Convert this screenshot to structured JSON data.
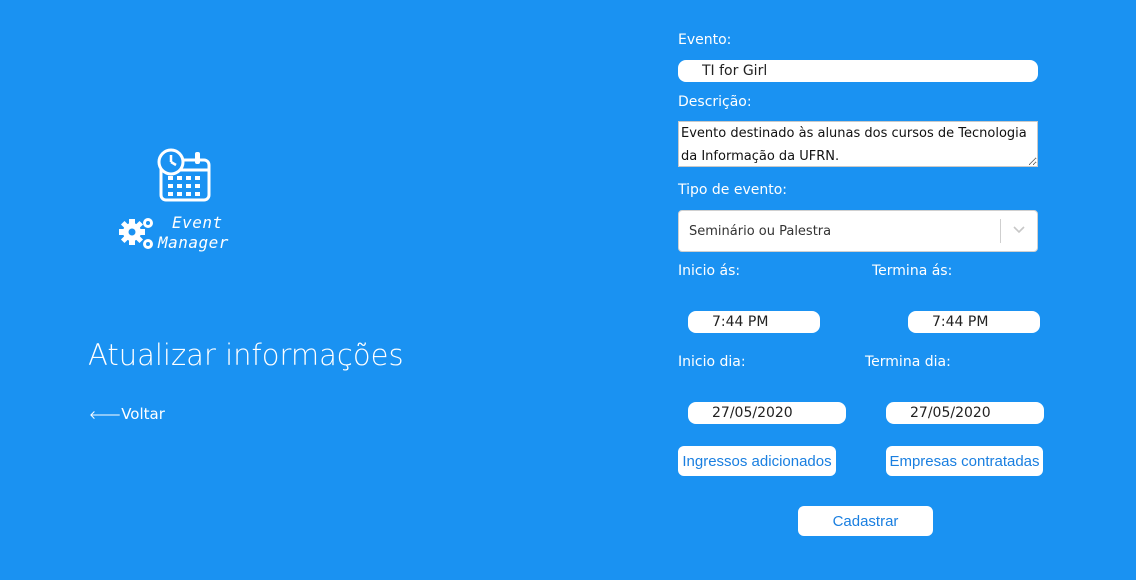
{
  "logo": {
    "line1": "Event",
    "line2": "Manager"
  },
  "page": {
    "title": "Atualizar informações",
    "back_label": "Voltar",
    "back_arrow": "🡐"
  },
  "form": {
    "evento_label": "Evento:",
    "evento_value": "TI for Girl",
    "descricao_label": "Descrição:",
    "descricao_value": "Evento destinado às alunas dos cursos de Tecnologia da Informação da UFRN.",
    "tipo_label": "Tipo de evento:",
    "tipo_value": "Seminário ou Palestra",
    "inicio_as_label": "Inicio ás:",
    "termina_as_label": "Termina ás:",
    "inicio_as_value": "7:44 PM",
    "termina_as_value": "7:44 PM",
    "inicio_dia_label": "Inicio dia:",
    "termina_dia_label": "Termina dia:",
    "inicio_dia_value": "27/05/2020",
    "termina_dia_value": "27/05/2020",
    "ingressos_button": "Ingressos adicionados",
    "empresas_button": "Empresas contratadas",
    "submit_button": "Cadastrar"
  },
  "colors": {
    "background": "#1a92f2",
    "button_text": "#1a7fe0"
  }
}
